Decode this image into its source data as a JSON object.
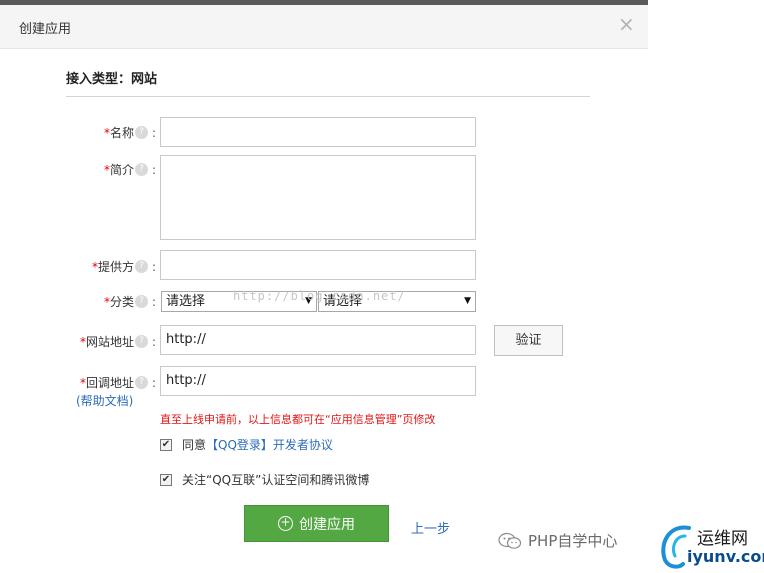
{
  "dialog": {
    "title": "创建应用",
    "close_glyph": "×"
  },
  "section": {
    "title": "接入类型：网站"
  },
  "form": {
    "required_mark": "*",
    "help_glyph": "?",
    "colon": ":",
    "name_label": "名称",
    "intro_label": "简介",
    "provider_label": "提供方",
    "category_label": "分类",
    "category_select1": "请选择",
    "category_select2": "请选择",
    "site_label": "网站地址",
    "site_value": "http://",
    "verify_label": "验证",
    "callback_label": "回调地址",
    "callback_value": "http://",
    "help_doc": "(帮助文档)",
    "warning": "直至上线申请前，以上信息都可在“应用信息管理”页修改"
  },
  "agreements": {
    "check_glyph": "✔",
    "agree_prefix": "同意",
    "agree_link": "【QQ登录】开发者协议",
    "follow_text": "关注“QQ互联”认证空间和腾讯微博",
    "agree_checked": true,
    "follow_checked": true
  },
  "actions": {
    "create_label": "创建应用",
    "prev_label": "上一步"
  },
  "watermarks": {
    "middle": "http://blog.csdn.net/",
    "php": "PHP自学中心",
    "logo_cn": "运维网",
    "logo_en": "iyunv.com"
  },
  "colors": {
    "accent_green": "#54a843",
    "link_blue": "#2d6db5",
    "warning_red": "#e01515"
  },
  "icons": {
    "close": "close-icon",
    "help": "question-circle-icon",
    "dropdown": "caret-down-icon",
    "check": "checkbox-icon",
    "create": "plus-circle-icon",
    "wechat": "wechat-icon"
  }
}
